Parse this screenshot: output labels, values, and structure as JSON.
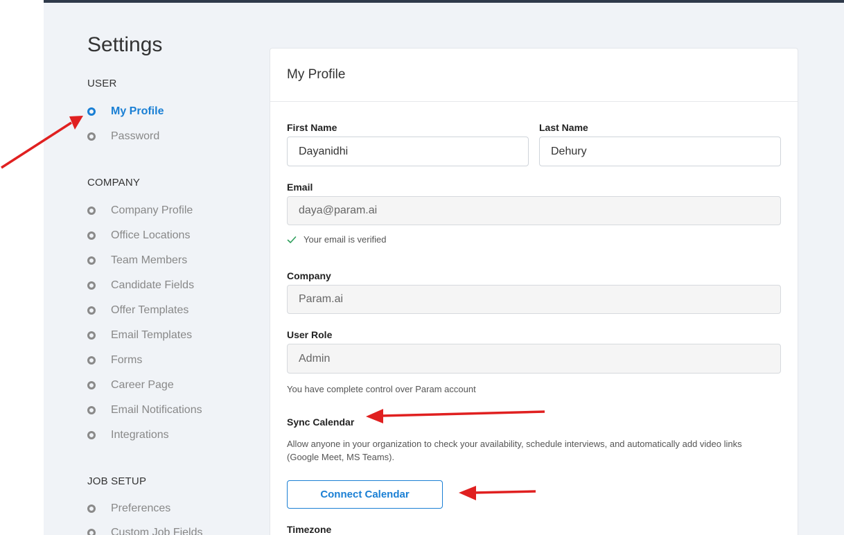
{
  "page": {
    "title": "Settings"
  },
  "sidebar": {
    "sections": [
      {
        "heading": "USER",
        "items": [
          {
            "label": "My Profile",
            "active": true
          },
          {
            "label": "Password"
          }
        ]
      },
      {
        "heading": "COMPANY",
        "items": [
          {
            "label": "Company Profile"
          },
          {
            "label": "Office Locations"
          },
          {
            "label": "Team Members"
          },
          {
            "label": "Candidate Fields"
          },
          {
            "label": "Offer Templates"
          },
          {
            "label": "Email Templates"
          },
          {
            "label": "Forms"
          },
          {
            "label": "Career Page"
          },
          {
            "label": "Email Notifications"
          },
          {
            "label": "Integrations"
          }
        ]
      },
      {
        "heading": "JOB SETUP",
        "items": [
          {
            "label": "Preferences"
          },
          {
            "label": "Custom Job Fields"
          }
        ]
      }
    ]
  },
  "profile": {
    "title": "My Profile",
    "first_name_label": "First Name",
    "first_name_value": "Dayanidhi",
    "last_name_label": "Last Name",
    "last_name_value": "Dehury",
    "email_label": "Email",
    "email_value": "daya@param.ai",
    "email_verified_text": "Your email is verified",
    "company_label": "Company",
    "company_value": "Param.ai",
    "role_label": "User Role",
    "role_value": "Admin",
    "role_help": "You have complete control over Param account",
    "sync_label": "Sync Calendar",
    "sync_help": "Allow anyone in your organization to check your availability, schedule interviews, and automatically add video links (Google Meet, MS Teams).",
    "connect_button": "Connect Calendar",
    "timezone_label": "Timezone"
  },
  "colors": {
    "accent": "#1a7fd4",
    "annotation_arrow": "#e02020",
    "verified_check": "#2e9e5b"
  }
}
